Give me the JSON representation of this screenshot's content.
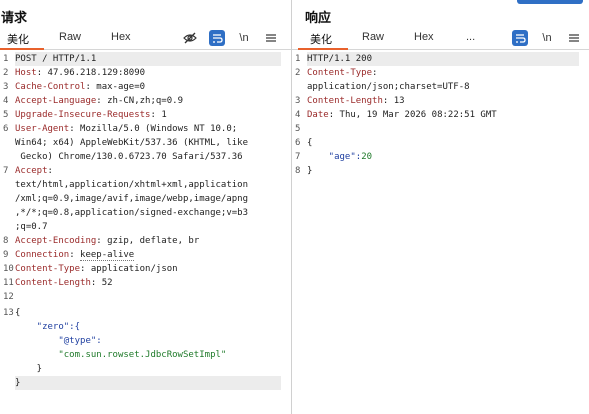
{
  "request": {
    "title": "请求",
    "tabs": [
      "美化",
      "Raw",
      "Hex"
    ],
    "active_tab": 0,
    "icons": [
      "eye-off-icon",
      "wrap-text-icon",
      "newline-icon",
      "menu-icon"
    ],
    "icon_glyph_newline": "\\n",
    "lines": [
      {
        "n": "1",
        "key": "POST / HTTP/1.1",
        "val": ""
      },
      {
        "n": "2",
        "key": "Host",
        "val": "47.96.218.129:8090"
      },
      {
        "n": "3",
        "key": "Cache-Control",
        "val": "max-age=0"
      },
      {
        "n": "4",
        "key": "Accept-Language",
        "val": "zh-CN,zh;q=0.9"
      },
      {
        "n": "5",
        "key": "Upgrade-Insecure-Requests",
        "val": "1"
      },
      {
        "n": "6",
        "key": "User-Agent",
        "val": "Mozilla/5.0 (Windows NT 10.0;"
      },
      {
        "n": "",
        "key": "",
        "val": "Win64; x64) AppleWebKit/537.36 (KHTML, like"
      },
      {
        "n": "",
        "key": "",
        "val": " Gecko) Chrome/130.0.6723.70 Safari/537.36"
      },
      {
        "n": "7",
        "key": "Accept",
        "val": ""
      },
      {
        "n": "",
        "key": "",
        "val": "text/html,application/xhtml+xml,application"
      },
      {
        "n": "",
        "key": "",
        "val": "/xml;q=0.9,image/avif,image/webp,image/apng"
      },
      {
        "n": "",
        "key": "",
        "val": ",*/*;q=0.8,application/signed-exchange;v=b3"
      },
      {
        "n": "",
        "key": "",
        "val": ";q=0.7"
      },
      {
        "n": "8",
        "key": "Accept-Encoding",
        "val": "gzip, deflate, br"
      },
      {
        "n": "9",
        "key": "Connection",
        "val": "keep-alive"
      },
      {
        "n": "10",
        "key": "Content-Type",
        "val": "application/json"
      },
      {
        "n": "11",
        "key": "Content-Length",
        "val": "52"
      },
      {
        "n": "12",
        "key": "",
        "val": ""
      }
    ],
    "body": [
      {
        "n": "13",
        "text": "{"
      },
      {
        "n": "",
        "text": "    \"zero\":{"
      },
      {
        "n": "",
        "text": "        \"@type\":"
      },
      {
        "n": "",
        "text": "        \"com.sun.rowset.JdbcRowSetImpl\""
      },
      {
        "n": "",
        "text": "    }"
      },
      {
        "n": "",
        "text": "}"
      }
    ]
  },
  "response": {
    "title": "响应",
    "tabs": [
      "美化",
      "Raw",
      "Hex",
      "..."
    ],
    "active_tab": 0,
    "icons": [
      "wrap-text-icon",
      "newline-icon",
      "menu-icon"
    ],
    "icon_glyph_newline": "\\n",
    "lines": [
      {
        "n": "1",
        "key": "HTTP/1.1 200",
        "val": ""
      },
      {
        "n": "2",
        "key": "Content-Type",
        "val": ""
      },
      {
        "n": "",
        "key": "",
        "val": "application/json;charset=UTF-8"
      },
      {
        "n": "3",
        "key": "Content-Length",
        "val": "13"
      },
      {
        "n": "4",
        "key": "Date",
        "val": "Thu, 19 Mar 2026 08:22:51 GMT"
      },
      {
        "n": "5",
        "key": "",
        "val": ""
      },
      {
        "n": "6",
        "key": "",
        "val": "{"
      },
      {
        "n": "7",
        "key": "",
        "val": "    \"age\":20"
      },
      {
        "n": "8",
        "key": "",
        "val": "}"
      }
    ]
  },
  "colors": {
    "accent": "#e8612c",
    "button_blue": "#2f6fc5",
    "header_key": "#9a2a2a",
    "json_key": "#1f3fa0",
    "json_value": "#1f7a2a"
  }
}
